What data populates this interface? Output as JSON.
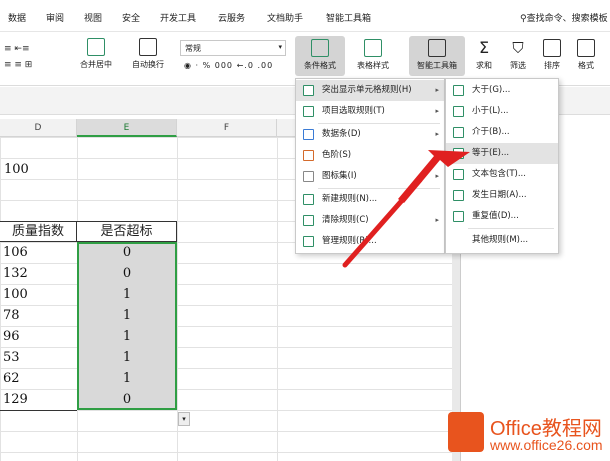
{
  "tabs": [
    "数据",
    "审阅",
    "视图",
    "安全",
    "开发工具",
    "云服务",
    "文档助手",
    "智能工具箱"
  ],
  "search": "查找命令、搜索模板",
  "ribbon": {
    "merge": "合并居中",
    "wrap": "自动换行",
    "number_format": "常规",
    "format_row": "◉ · %  000  ←.0  .00",
    "conditional": "条件格式",
    "table_style": "表格样式",
    "smart_toolbox": "智能工具箱",
    "sum": "求和",
    "filter": "筛选",
    "sort": "排序",
    "format": "格式"
  },
  "columns": {
    "d": "D",
    "e": "E",
    "f": "F"
  },
  "cells": {
    "d_top": "100",
    "header_d": "质量指数",
    "header_e": "是否超标"
  },
  "d_values": [
    "106",
    "132",
    "100",
    "78",
    "96",
    "53",
    "62",
    "129"
  ],
  "e_values": [
    "0",
    "0",
    "1",
    "1",
    "1",
    "1",
    "1",
    "0"
  ],
  "menu1": [
    {
      "label": "突出显示单元格规则(H)",
      "arrow": "▸"
    },
    {
      "label": "项目选取规则(T)",
      "arrow": "▸"
    },
    {
      "label": "数据条(D)",
      "arrow": "▸"
    },
    {
      "label": "色阶(S)",
      "arrow": "▸"
    },
    {
      "label": "图标集(I)",
      "arrow": "▸"
    },
    {
      "label": "新建规则(N)...",
      "arrow": ""
    },
    {
      "label": "清除规则(C)",
      "arrow": "▸"
    },
    {
      "label": "管理规则(R)...",
      "arrow": ""
    }
  ],
  "menu2": [
    {
      "label": "大于(G)..."
    },
    {
      "label": "小于(L)..."
    },
    {
      "label": "介于(B)..."
    },
    {
      "label": "等于(E)..."
    },
    {
      "label": "文本包含(T)..."
    },
    {
      "label": "发生日期(A)..."
    },
    {
      "label": "重复值(D)..."
    },
    {
      "label": "其他规则(M)..."
    }
  ],
  "logo": {
    "title": "Office教程网",
    "url": "www.office26.com"
  },
  "colors": {
    "accent": "#2f9e44",
    "arrow": "#e02020",
    "logo": "#e8541e"
  }
}
